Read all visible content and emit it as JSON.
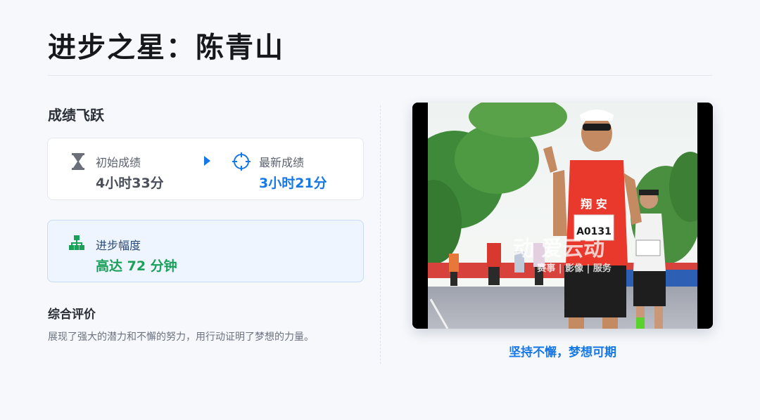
{
  "page": {
    "title": "进步之星：陈青山"
  },
  "achievement": {
    "section_title": "成绩飞跃",
    "start": {
      "label": "初始成绩",
      "value": "4小时33分",
      "icon": "hourglass-icon"
    },
    "latest": {
      "label": "最新成绩",
      "value": "3小时21分",
      "icon": "target-icon"
    },
    "arrow_icon": "play-arrow-icon"
  },
  "progress": {
    "label": "进步幅度",
    "value": "高达 72 分钟",
    "icon": "hierarchy-icon"
  },
  "evaluation": {
    "title": "综合评价",
    "text": "展现了强大的潜力和不懈的努力，用行动证明了梦想的力量。"
  },
  "photo": {
    "bib": "A0131",
    "singlet_text": "翔 安",
    "watermark_main": "动 爱云动",
    "watermark_sub": "赛事 | 影像 | 服务",
    "caption": "坚持不懈，梦想可期"
  },
  "colors": {
    "accent_blue": "#1677e6",
    "accent_green": "#1ba05a",
    "background": "#f6f8fc"
  }
}
